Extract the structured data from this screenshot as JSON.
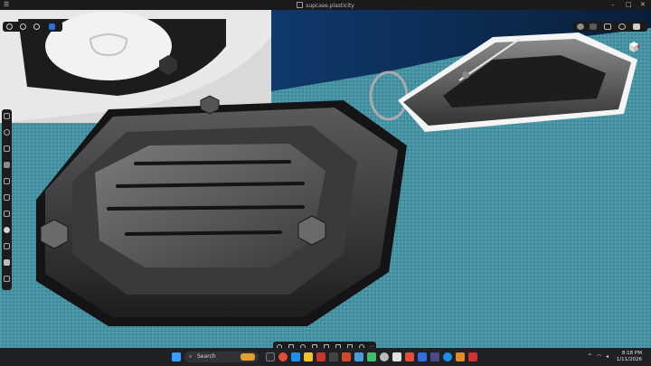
{
  "window": {
    "title": "supcase.plasticity",
    "minimize_icon": "minimize-icon",
    "maximize_icon": "maximize-icon",
    "close_icon": "close-icon"
  },
  "viewport": {
    "description_icons": [
      "object-mode-icon",
      "edit-mode-icon",
      "render-mode-icon",
      "view-settings-icon"
    ]
  },
  "taskbar": {
    "search_placeholder": "Search",
    "time": "8:18 PM",
    "date": "1/11/2026"
  },
  "colors": {
    "accent": "#2f6de0",
    "fabric": "#3f8ea0",
    "taskbar": "#202124",
    "titlebar": "#1a1a1d"
  }
}
